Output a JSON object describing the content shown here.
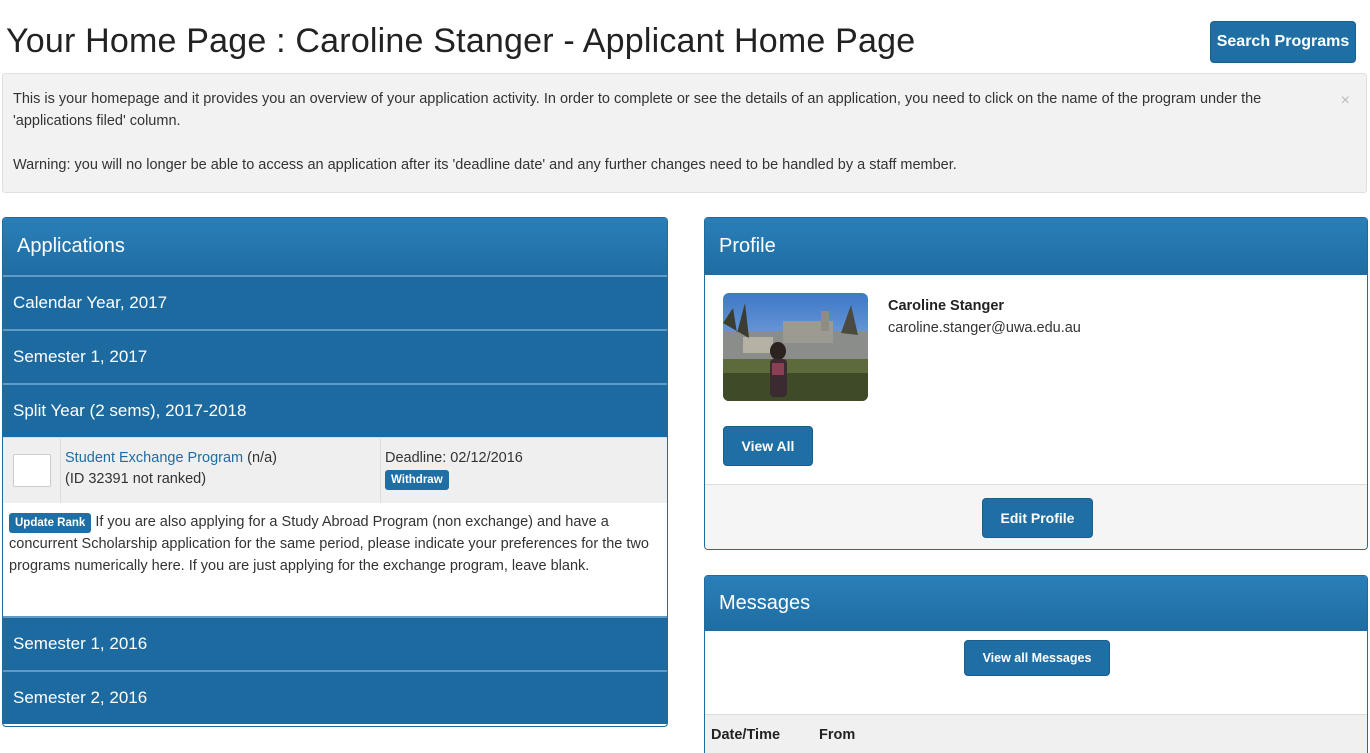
{
  "page": {
    "title": "Your Home Page : Caroline Stanger - Applicant Home Page",
    "search_button": "Search Programs"
  },
  "info": {
    "line1": "This is your homepage and it provides you an overview of your application activity. In order to complete or see the details of an application, you need to click on the name of the program under the 'applications filed' column.",
    "line2": "Warning: you will no longer be able to access an application after its 'deadline date' and any further changes need to be handled by a staff member.",
    "close": "×"
  },
  "applications": {
    "heading": "Applications",
    "groups": [
      "Calendar Year, 2017",
      "Semester 1, 2017",
      "Split Year (2 sems), 2017-2018",
      "Semester 1, 2016",
      "Semester 2, 2016"
    ],
    "row": {
      "program": "Student Exchange Program",
      "program_suffix": " (n/a)",
      "id_text": "(ID 32391 not ranked)",
      "deadline": "Deadline: 02/12/2016",
      "withdraw": "Withdraw"
    },
    "rank_note": {
      "button": "Update Rank",
      "text": " If you are also applying for a Study Abroad Program (non exchange) and have a concurrent Scholarship application for the same period, please indicate your preferences for the two programs numerically here. If you are just applying for the exchange program, leave blank."
    }
  },
  "profile": {
    "heading": "Profile",
    "name": "Caroline Stanger",
    "email": "caroline.stanger@uwa.edu.au",
    "view_all": "View All",
    "edit": "Edit Profile"
  },
  "messages": {
    "heading": "Messages",
    "view_all": "View all Messages",
    "columns": [
      "Date/Time",
      "From"
    ]
  }
}
